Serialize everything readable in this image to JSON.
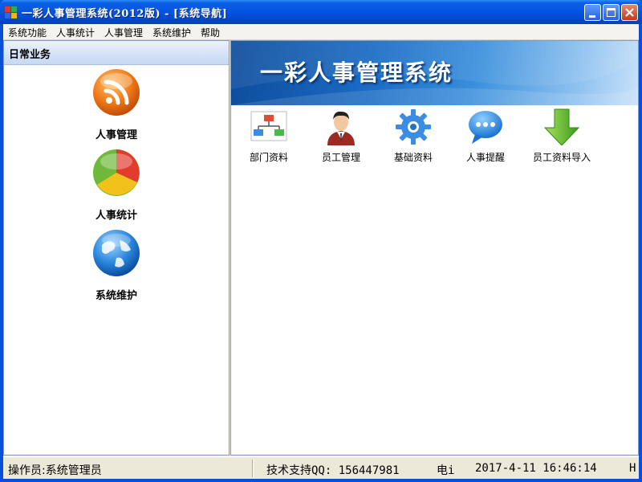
{
  "window": {
    "title": "一彩人事管理系统(2012版) - [系统导航]"
  },
  "menubar": {
    "items": [
      "系统功能",
      "人事统计",
      "人事管理",
      "系统维护",
      "帮助"
    ]
  },
  "left_panel": {
    "header": "日常业务",
    "items": [
      {
        "label": "人事管理",
        "icon": "rss-icon"
      },
      {
        "label": "人事统计",
        "icon": "pie-chart-icon"
      },
      {
        "label": "系统维护",
        "icon": "globe-icon"
      }
    ]
  },
  "right_panel": {
    "banner_title": "一彩人事管理系统",
    "tools": [
      {
        "label": "部门资料",
        "icon": "org-chart-icon"
      },
      {
        "label": "员工管理",
        "icon": "employee-icon"
      },
      {
        "label": "基础资料",
        "icon": "gear-icon"
      },
      {
        "label": "人事提醒",
        "icon": "chat-bubble-icon"
      },
      {
        "label": "员工资料导入",
        "icon": "download-arrow-icon"
      }
    ]
  },
  "statusbar": {
    "operator": "操作员:系统管理员",
    "support": "技术支持QQ: 156447981",
    "phone": "电i",
    "datetime": "2017-4-11 16:46:14",
    "extra": "H"
  },
  "colors": {
    "titlebar": "#0554e1",
    "banner": "#1a6cc4",
    "panel_border": "#7f9db9"
  }
}
